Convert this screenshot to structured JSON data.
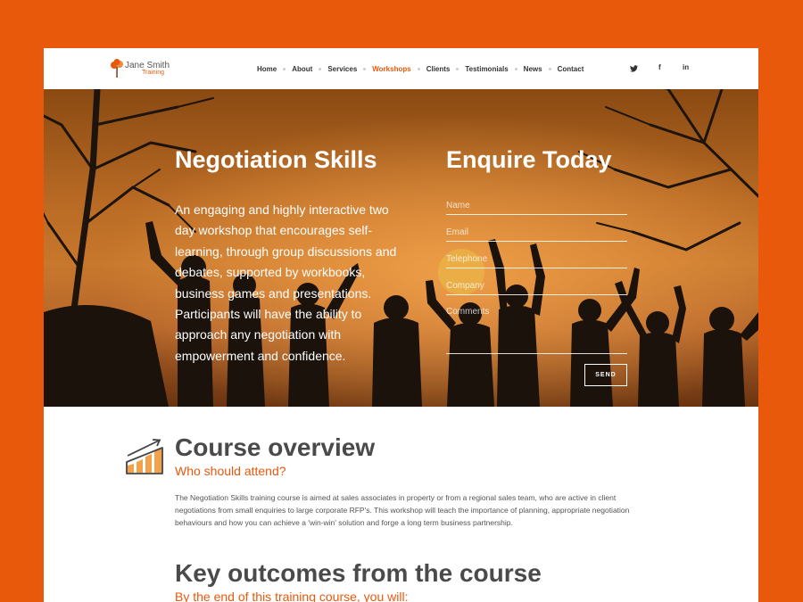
{
  "logo": {
    "name": "Jane Smith",
    "sub": "Training"
  },
  "nav": {
    "items": [
      {
        "label": "Home"
      },
      {
        "label": "About"
      },
      {
        "label": "Services"
      },
      {
        "label": "Workshops",
        "active": true
      },
      {
        "label": "Clients"
      },
      {
        "label": "Testimonials"
      },
      {
        "label": "News"
      },
      {
        "label": "Contact"
      }
    ],
    "social": {
      "twitter": "twitter-icon",
      "facebook": "f",
      "linkedin": "in"
    }
  },
  "hero": {
    "title": "Negotiation Skills",
    "text": "An engaging and highly interactive two day workshop that encourages self-learning, through group discussions and debates, supported by workbooks, business games and presentations. Participants will have the ability to approach any negotiation with empowerment and confidence."
  },
  "enquire": {
    "title": "Enquire Today",
    "fields": {
      "name": "Name",
      "email": "Email",
      "telephone": "Telephone",
      "company": "Company",
      "comments": "Comments"
    },
    "send": "SEND"
  },
  "overview": {
    "title": "Course overview",
    "subtitle": "Who should attend?",
    "text": "The Negotiation Skills training course is aimed at sales associates in property or from a regional sales team, who are active in client negotiations from small enquiries to large corporate RFP's. This workshop will teach the importance of planning, appropriate negotiation behaviours and how you can achieve a 'win-win' solution and forge a long term business partnership."
  },
  "outcomes": {
    "title": "Key outcomes from the course",
    "subtitle": "By the end of this training course, you will:"
  },
  "colors": {
    "accent": "#e8590c",
    "text": "#4a4a4a"
  }
}
